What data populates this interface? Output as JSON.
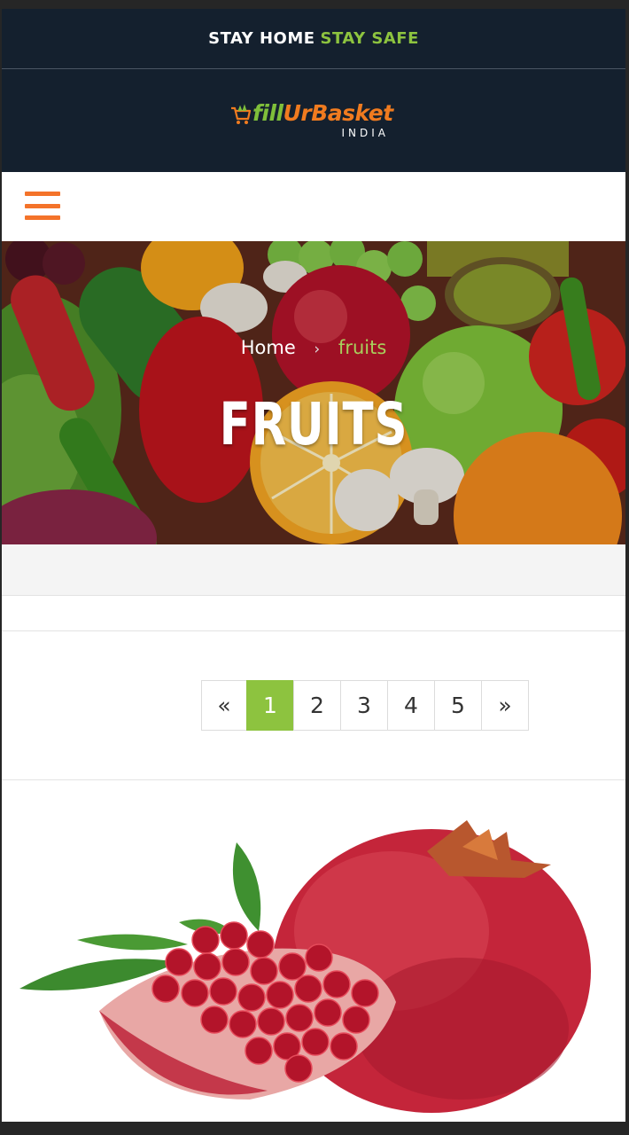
{
  "topbar": {
    "text_white": "STAY HOME",
    "text_green": "STAY SAFE"
  },
  "brand": {
    "name_part1": "fill",
    "name_part2": "Ur",
    "name_part3": "Basket",
    "subtitle": "INDIA"
  },
  "nav": {
    "menu_icon": "hamburger-menu-icon"
  },
  "breadcrumb": {
    "home": "Home",
    "separator": "›",
    "current": "fruits"
  },
  "hero": {
    "title": "FRUITS"
  },
  "pagination": {
    "prev": "«",
    "pages": [
      "1",
      "2",
      "3",
      "4",
      "5"
    ],
    "active_page": "1",
    "next": "»"
  },
  "colors": {
    "dark_navy": "#14202e",
    "accent_green": "#8dc33f",
    "accent_orange": "#f4732a"
  }
}
